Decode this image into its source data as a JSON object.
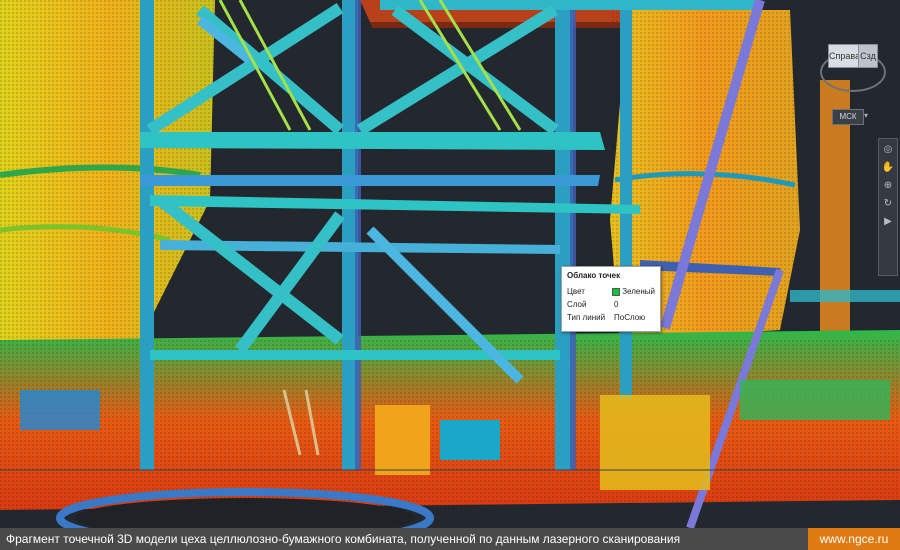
{
  "viewcube": {
    "front_label": "Справа",
    "side_label": "Сзд"
  },
  "ucs": {
    "label": "МСК",
    "arrow": "▾"
  },
  "navbar": {
    "icons": [
      "wheel-icon",
      "pan-icon",
      "zoom-icon",
      "orbit-icon",
      "showmotion-icon"
    ]
  },
  "quick_properties": {
    "title": "Облако точек",
    "rows": [
      {
        "label": "Цвет",
        "value": "Зеленый",
        "swatch_color": "#12c43a"
      },
      {
        "label": "Слой",
        "value": "0"
      },
      {
        "label": "Тип линий",
        "value": "ПоСлою"
      }
    ]
  },
  "caption": {
    "text": "Фрагмент точечной 3D модели цеха целлюлозно-бумажного комбината, полученной по данным лазерного сканирования",
    "url": "www.ngce.ru"
  },
  "colors": {
    "viewport_background": "#22262d",
    "caption_background": "#4a4a4a",
    "url_background": "#e07a12"
  }
}
